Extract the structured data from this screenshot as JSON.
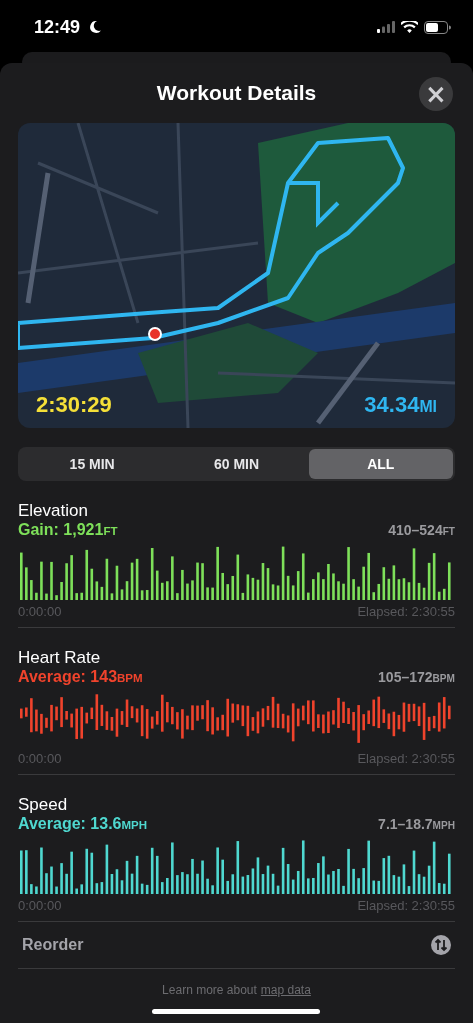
{
  "status_bar": {
    "time": "12:49"
  },
  "sheet": {
    "title": "Workout Details",
    "close": "×"
  },
  "map": {
    "duration": "2:30:29",
    "distance": "34.34",
    "distance_unit": "MI"
  },
  "segments": [
    {
      "label": "15 MIN",
      "selected": false
    },
    {
      "label": "60 MIN",
      "selected": false
    },
    {
      "label": "ALL",
      "selected": true
    }
  ],
  "metrics": [
    {
      "kind": "bars",
      "name": "Elevation",
      "value": "Gain: 1,921",
      "unit": "FT",
      "range": "410–524",
      "range_unit": "FT",
      "color": "#7ee05a",
      "start": "0:00:00",
      "end": "Elapsed: 2:30:55"
    },
    {
      "kind": "ranges",
      "name": "Heart Rate",
      "value": "Average: 143",
      "unit": "BPM",
      "range": "105–172",
      "range_unit": "BPM",
      "color": "#f0432c",
      "start": "0:00:00",
      "end": "Elapsed: 2:30:55"
    },
    {
      "kind": "bars",
      "name": "Speed",
      "value": "Average: 13.6",
      "unit": "MPH",
      "range": "7.1–18.7",
      "range_unit": "MPH",
      "color": "#4fd8d0",
      "start": "0:00:00",
      "end": "Elapsed: 2:30:55"
    }
  ],
  "reorder": {
    "label": "Reorder"
  },
  "footer": {
    "text": "Learn more about",
    "link": "map data"
  }
}
